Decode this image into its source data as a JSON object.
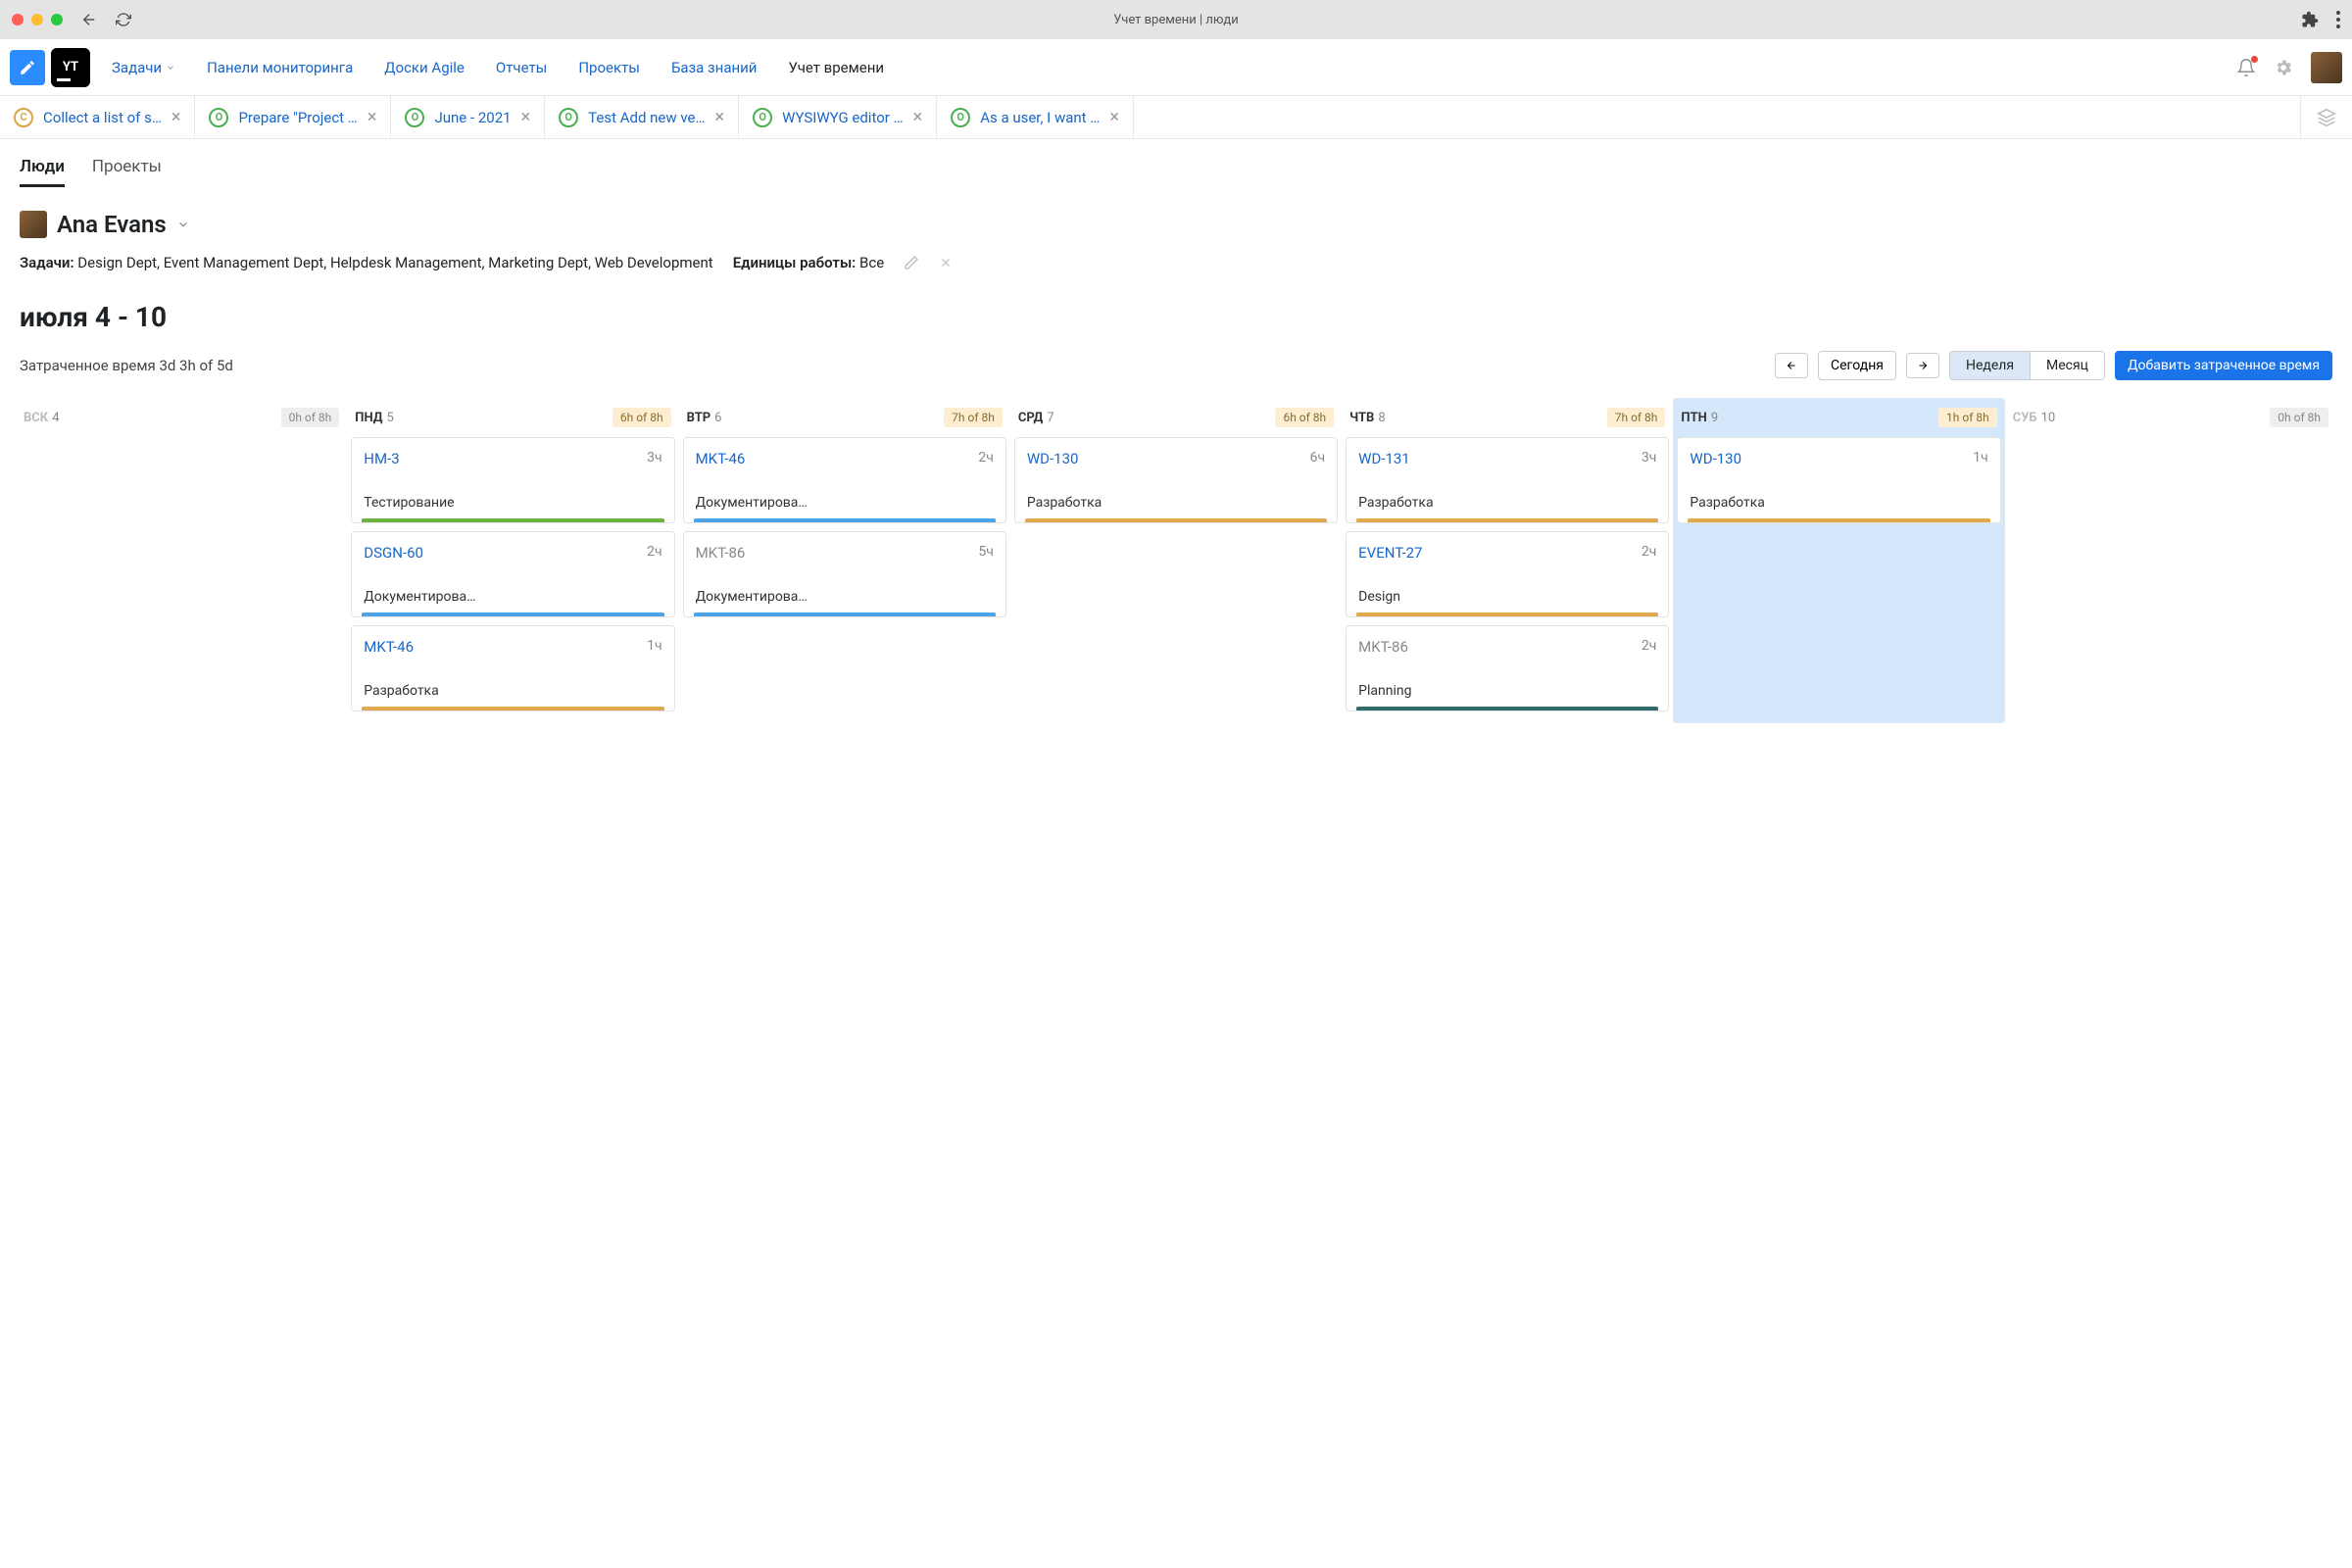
{
  "titlebar": {
    "title": "Учет времени | люди"
  },
  "nav": {
    "items": [
      "Задачи",
      "Панели мониторинга",
      "Доски Agile",
      "Отчеты",
      "Проекты",
      "База знаний",
      "Учет времени"
    ],
    "activeIndex": 6
  },
  "tabs": [
    {
      "badge": "C",
      "badgeClass": "c",
      "label": "Collect a list of s…"
    },
    {
      "badge": "O",
      "badgeClass": "o",
      "label": "Prepare \"Project …"
    },
    {
      "badge": "O",
      "badgeClass": "o",
      "label": "June - 2021"
    },
    {
      "badge": "O",
      "badgeClass": "o",
      "label": "Test Add new ve…"
    },
    {
      "badge": "O",
      "badgeClass": "o",
      "label": "WYSIWYG editor …"
    },
    {
      "badge": "O",
      "badgeClass": "o",
      "label": "As a user, I want …"
    }
  ],
  "subtabs": {
    "items": [
      "Люди",
      "Проекты"
    ],
    "activeIndex": 0
  },
  "person": {
    "name": "Ana Evans"
  },
  "filters": {
    "tasksLabel": "Задачи:",
    "tasksValue": "Design Dept, Event Management Dept, Helpdesk Management, Marketing Dept, Web Development",
    "unitsLabel": "Единицы работы:",
    "unitsValue": "Все"
  },
  "period": "июля 4 - 10",
  "spent": {
    "label": "Затраченное время",
    "value": "3d 3h of 5d"
  },
  "toolbar": {
    "today": "Сегодня",
    "view": {
      "week": "Неделя",
      "month": "Месяц"
    },
    "add": "Добавить затраченное время"
  },
  "days": [
    {
      "short": "ВСК",
      "num": "4",
      "faded": true,
      "badge": "0h of 8h",
      "badgeGray": true,
      "today": false,
      "cards": []
    },
    {
      "short": "ПНД",
      "num": "5",
      "faded": false,
      "badge": "6h of 8h",
      "badgeGray": false,
      "today": false,
      "cards": [
        {
          "id": "HM-3",
          "idGray": false,
          "hrs": "3ч",
          "type": "Тестирование",
          "bar": "bar-green"
        },
        {
          "id": "DSGN-60",
          "idGray": false,
          "hrs": "2ч",
          "type": "Документирова…",
          "bar": "bar-blue"
        },
        {
          "id": "MKT-46",
          "idGray": false,
          "hrs": "1ч",
          "type": "Разработка",
          "bar": "bar-amber"
        }
      ]
    },
    {
      "short": "ВТР",
      "num": "6",
      "faded": false,
      "badge": "7h of 8h",
      "badgeGray": false,
      "today": false,
      "cards": [
        {
          "id": "MKT-46",
          "idGray": false,
          "hrs": "2ч",
          "type": "Документирова…",
          "bar": "bar-blue"
        },
        {
          "id": "MKT-86",
          "idGray": true,
          "hrs": "5ч",
          "type": "Документирова…",
          "bar": "bar-blue"
        }
      ]
    },
    {
      "short": "СРД",
      "num": "7",
      "faded": false,
      "badge": "6h of 8h",
      "badgeGray": false,
      "today": false,
      "cards": [
        {
          "id": "WD-130",
          "idGray": false,
          "hrs": "6ч",
          "type": "Разработка",
          "bar": "bar-amber"
        }
      ]
    },
    {
      "short": "ЧТВ",
      "num": "8",
      "faded": false,
      "badge": "7h of 8h",
      "badgeGray": false,
      "today": false,
      "cards": [
        {
          "id": "WD-131",
          "idGray": false,
          "hrs": "3ч",
          "type": "Разработка",
          "bar": "bar-amber"
        },
        {
          "id": "EVENT-27",
          "idGray": false,
          "hrs": "2ч",
          "type": "Design",
          "bar": "bar-amber"
        },
        {
          "id": "MKT-86",
          "idGray": true,
          "hrs": "2ч",
          "type": "Planning",
          "bar": "bar-teal"
        }
      ]
    },
    {
      "short": "ПТН",
      "num": "9",
      "faded": false,
      "badge": "1h of 8h",
      "badgeGray": false,
      "today": true,
      "cards": [
        {
          "id": "WD-130",
          "idGray": false,
          "hrs": "1ч",
          "type": "Разработка",
          "bar": "bar-amber"
        }
      ]
    },
    {
      "short": "СУБ",
      "num": "10",
      "faded": true,
      "badge": "0h of 8h",
      "badgeGray": true,
      "today": false,
      "cards": []
    }
  ]
}
